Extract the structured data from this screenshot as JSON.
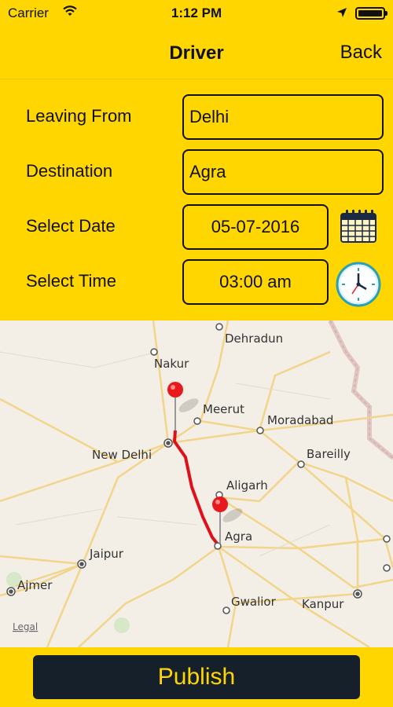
{
  "status": {
    "carrier": "Carrier",
    "time": "1:12 PM"
  },
  "nav": {
    "title": "Driver",
    "back_label": "Back"
  },
  "form": {
    "leaving_from": {
      "label": "Leaving From",
      "value": "Delhi"
    },
    "destination": {
      "label": "Destination",
      "value": "Agra"
    },
    "date": {
      "label": "Select Date",
      "value": "05-07-2016"
    },
    "time": {
      "label": "Select Time",
      "value": "03:00 am"
    }
  },
  "map": {
    "cities": {
      "dehradun": "Dehradun",
      "nakur": "Nakur",
      "meerut": "Meerut",
      "moradabad": "Moradabad",
      "new_delhi": "New Delhi",
      "bareilly": "Bareilly",
      "aligarh": "Aligarh",
      "agra": "Agra",
      "jaipur": "Jaipur",
      "ajmer": "Ajmer",
      "gwalior": "Gwalior",
      "kanpur": "Kanpur"
    },
    "legal": "Legal",
    "route_color": "#e0101a",
    "pin_color": "#e8191c"
  },
  "actions": {
    "publish_label": "Publish"
  },
  "colors": {
    "accent": "#ffd600",
    "button_bg": "#16202a"
  }
}
